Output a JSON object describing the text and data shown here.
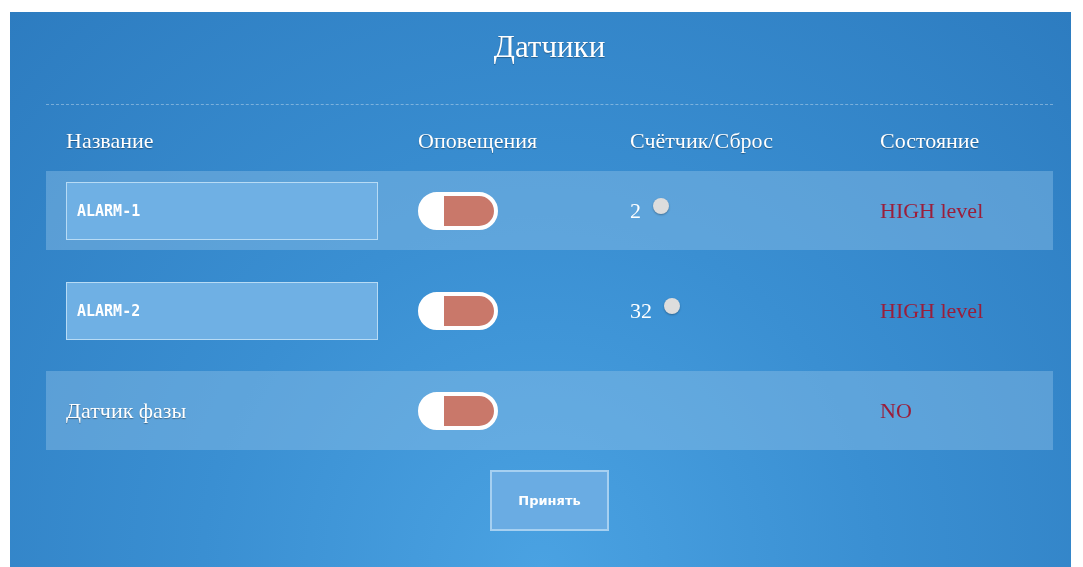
{
  "title": "Датчики",
  "columns": [
    "Название",
    "Оповещения",
    "Счётчик/Сброс",
    "Состояние"
  ],
  "rows": [
    {
      "kind": "input",
      "name": "ALARM-1",
      "notify_on": true,
      "counter": "2",
      "reset_selected": false,
      "status": "HIGH level"
    },
    {
      "kind": "input",
      "name": "ALARM-2",
      "notify_on": true,
      "counter": "32",
      "reset_selected": false,
      "status": "HIGH level"
    },
    {
      "kind": "label",
      "name": "Датчик фазы",
      "notify_on": true,
      "status": "NO"
    }
  ],
  "button": "Принять"
}
